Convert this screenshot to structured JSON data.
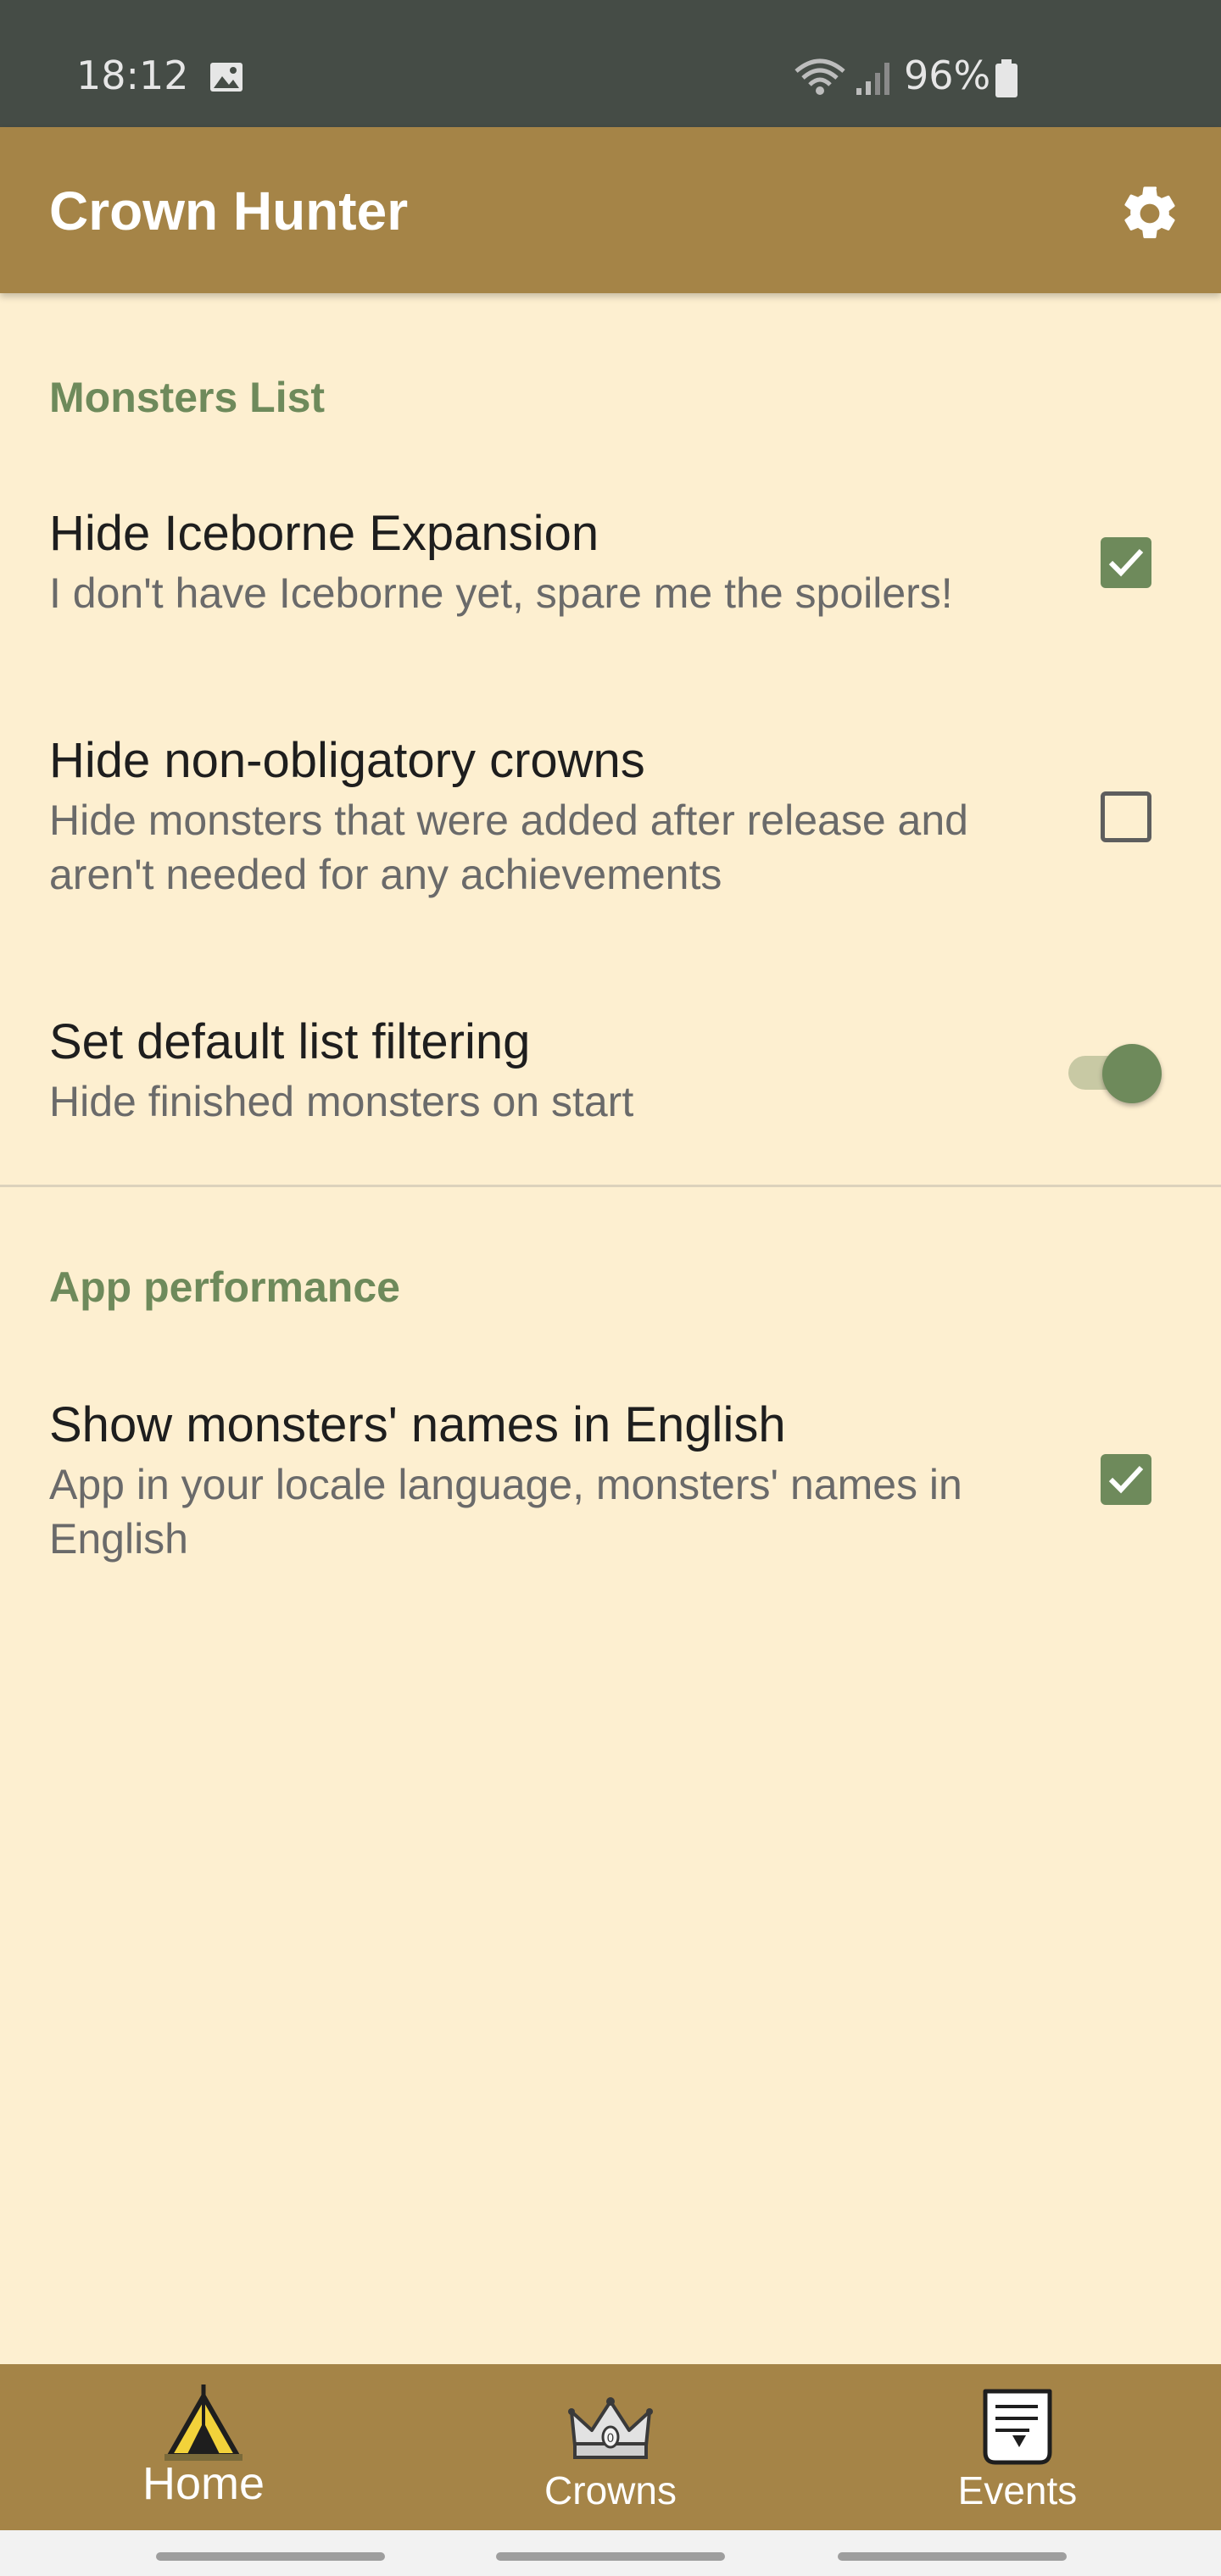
{
  "status_bar": {
    "time": "18:12",
    "battery": "96%"
  },
  "app_bar": {
    "title": "Crown Hunter",
    "settings_icon": "gear-icon"
  },
  "sections": [
    {
      "header": "Monsters List",
      "items": [
        {
          "title": "Hide Iceborne Expansion",
          "summary": "I don't have Iceborne yet, spare me the spoilers!",
          "control": "checkbox",
          "checked": true
        },
        {
          "title": "Hide non-obligatory crowns",
          "summary": "Hide monsters that were added after release and aren't needed for any achievements",
          "control": "checkbox",
          "checked": false
        },
        {
          "title": "Set default list filtering",
          "summary": "Hide finished monsters on start",
          "control": "switch",
          "checked": true
        }
      ]
    },
    {
      "header": "App performance",
      "items": [
        {
          "title": "Show monsters' names in English",
          "summary": "App in your locale language, monsters' names in English",
          "control": "checkbox",
          "checked": true
        }
      ]
    }
  ],
  "bottom_nav": [
    {
      "label": "Home",
      "icon": "tent-icon",
      "active": true
    },
    {
      "label": "Crowns",
      "icon": "crown-icon",
      "active": false
    },
    {
      "label": "Events",
      "icon": "scroll-icon",
      "active": false
    }
  ],
  "colors": {
    "background": "#FDEFD0",
    "app_bar": "#A58447",
    "status_bar": "#454C46",
    "accent": "#6E8A5B"
  }
}
